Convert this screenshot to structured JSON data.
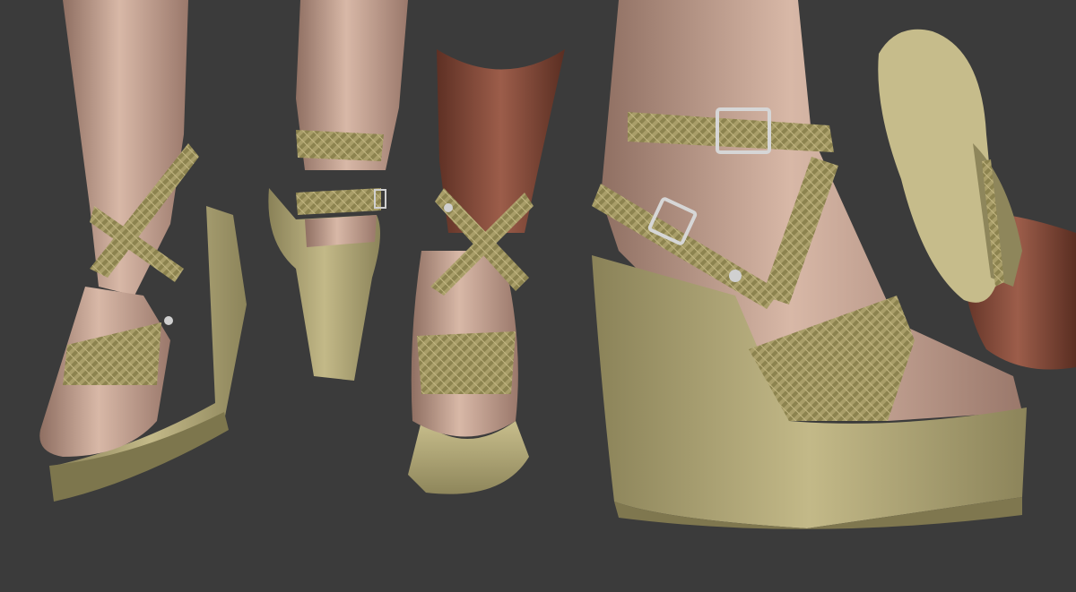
{
  "scene": {
    "background": "#3b3b3b",
    "description_colors": {
      "skin": "#d4b3a2",
      "skin_shadow": "#9c7a6c",
      "dark_skin": "#8a4e3c",
      "strap": "#a89d68",
      "strap_dark": "#6f6742",
      "sole": "#bdb282",
      "sole_dark": "#7f774f",
      "metal": "#cfcfcf"
    }
  }
}
